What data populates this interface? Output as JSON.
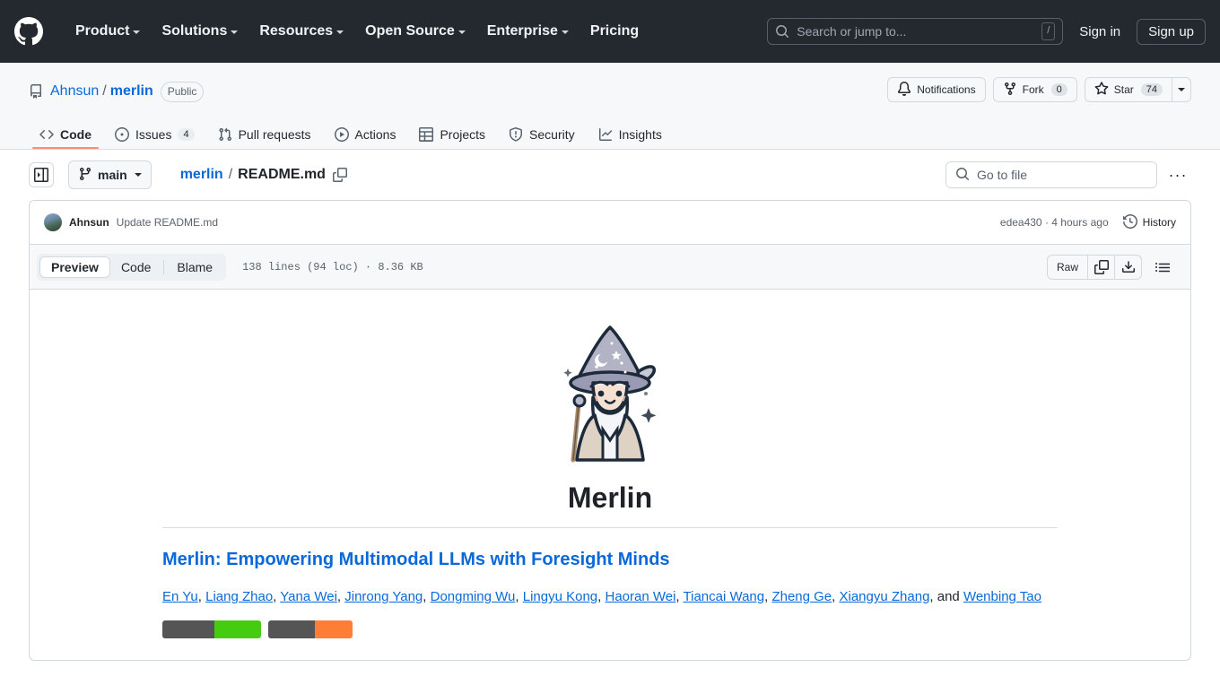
{
  "global_header": {
    "logo": "github-logo",
    "nav": [
      {
        "label": "Product",
        "has_caret": true
      },
      {
        "label": "Solutions",
        "has_caret": true
      },
      {
        "label": "Resources",
        "has_caret": true
      },
      {
        "label": "Open Source",
        "has_caret": true
      },
      {
        "label": "Enterprise",
        "has_caret": true
      },
      {
        "label": "Pricing",
        "has_caret": false
      }
    ],
    "search": {
      "placeholder": "Search or jump to...",
      "shortcut": "/"
    },
    "sign_in": "Sign in",
    "sign_up": "Sign up"
  },
  "repo": {
    "owner": "Ahnsun",
    "separator": "/",
    "name": "merlin",
    "visibility": "Public",
    "actions": {
      "notifications": "Notifications",
      "fork_label": "Fork",
      "fork_count": "0",
      "star_label": "Star",
      "star_count": "74"
    },
    "tabs": [
      {
        "label": "Code",
        "icon": "code-icon",
        "count": null,
        "active": true
      },
      {
        "label": "Issues",
        "icon": "issue-opened-icon",
        "count": "4",
        "active": false
      },
      {
        "label": "Pull requests",
        "icon": "git-pull-request-icon",
        "count": null,
        "active": false
      },
      {
        "label": "Actions",
        "icon": "play-icon",
        "count": null,
        "active": false
      },
      {
        "label": "Projects",
        "icon": "table-icon",
        "count": null,
        "active": false
      },
      {
        "label": "Security",
        "icon": "shield-icon",
        "count": null,
        "active": false
      },
      {
        "label": "Insights",
        "icon": "graph-icon",
        "count": null,
        "active": false
      }
    ]
  },
  "file_nav": {
    "sidebar_toggle": "sidebar-expand-icon",
    "branch": "main",
    "breadcrumb_repo": "merlin",
    "breadcrumb_sep": "/",
    "breadcrumb_file": "README.md",
    "copy_path": "copy-path-icon",
    "go_to_file_placeholder": "Go to file",
    "more_options": "···"
  },
  "commit": {
    "author": "Ahnsun",
    "message": "Update README.md",
    "hash_and_time": "edea430 · 4 hours ago",
    "history_label": "History"
  },
  "file_toolbar": {
    "views": [
      {
        "label": "Preview",
        "active": true
      },
      {
        "label": "Code",
        "active": false
      },
      {
        "label": "Blame",
        "active": false
      }
    ],
    "file_meta": "138 lines (94 loc) · 8.36 KB",
    "raw_label": "Raw",
    "copy_icon": "copy-icon",
    "download_icon": "download-icon",
    "outline_icon": "outline-icon"
  },
  "readme": {
    "logo_alt": "merlin-wizard-logo",
    "title": "Merlin",
    "subtitle": "Merlin: Empowering Multimodal LLMs with Foresight Minds",
    "authors": [
      "En Yu",
      "Liang Zhao",
      "Yana Wei",
      "Jinrong Yang",
      "Dongming Wu",
      "Lingyu Kong",
      "Haoran Wei",
      "Tiancai Wang",
      "Zheng Ge",
      "Xiangyu Zhang"
    ],
    "authors_conjunction": "and",
    "authors_last": "Wenbing Tao",
    "badges": [
      {
        "left": "",
        "right": "",
        "right_color": "#4c1"
      },
      {
        "left": "",
        "right": "",
        "right_color": "#fe7d37"
      }
    ]
  },
  "colors": {
    "header_bg": "#24292f",
    "link": "#0969da",
    "active_tab_underline": "#fd8c73",
    "border": "#d1d9e0",
    "muted_text": "#59636e"
  }
}
